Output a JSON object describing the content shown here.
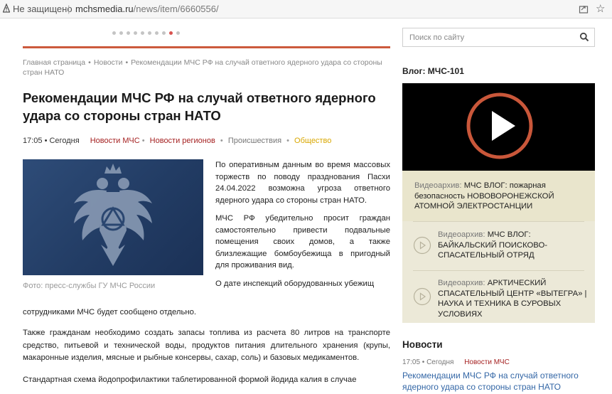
{
  "browser": {
    "security_label": "Не защищено",
    "separator": "|",
    "url_host": "mchsmedia.ru",
    "url_path": "/news/item/6660556/"
  },
  "slider": {
    "total": 10,
    "active": 9
  },
  "search": {
    "placeholder": "Поиск по сайту"
  },
  "breadcrumb": {
    "home": "Главная страница",
    "news": "Новости",
    "current": "Рекомендации МЧС РФ на случай ответного ядерного удара со стороны стран НАТО",
    "bullet": "•"
  },
  "article": {
    "title": "Рекомендации МЧС РФ на случай ответного ядерного удара со стороны стран НАТО",
    "time": "17:05 • Сегодня",
    "tags": [
      "Новости МЧС",
      "Новости регионов",
      "Происшествия",
      "Общество"
    ],
    "tag_colors": [
      "#a52222",
      "#a52222",
      "#777777",
      "#d9a700"
    ],
    "photo_caption": "Фото: пресс-службы ГУ МЧС России",
    "side_paragraphs": [
      "По оперативным данным во время массовых торжеств по поводу празднования Пасхи 24.04.2022 возможна угроза ответного ядерного удара со стороны стран НАТО.",
      "МЧС РФ убедительно просит граждан самостоятельно привести подвальные помещения своих домов, а также близлежащие бомбоубежища в пригодный для проживания вид.",
      "О дате инспекций оборудованных убежищ"
    ],
    "para3_tail": "сотрудниками МЧС будет сообщено отдельно.",
    "para4": "Также гражданам необходимо создать запасы топлива из расчета 80 литров на транспорте средство, питьевой и технической воды, продуктов питания длительного хранения (крупы, макаронные изделия, мясные и рыбные консервы, сахар, соль) и базовых медикаментов.",
    "para5": "Стандартная схема йодопрофилактики таблетированной формой йодида калия в случае"
  },
  "sidebar": {
    "vlog_title": "Влог: МЧС-101",
    "video_items": [
      {
        "label": "Видеоархив:",
        "title": "МЧС ВЛОГ: пожарная безопасность НОВОВОРОНЕЖСКОЙ АТОМНОЙ ЭЛЕКТРОСТАНЦИИ"
      },
      {
        "label": "Видеоархив:",
        "title": "МЧС ВЛОГ: БАЙКАЛЬСКИЙ ПОИСКОВО-СПАСАТЕЛЬНЫЙ ОТРЯД"
      },
      {
        "label": "Видеоархив:",
        "title": "АРКТИЧЕСКИЙ СПАСАТЕЛЬНЫЙ ЦЕНТР «ВЫТЕГРА» | НАУКА И ТЕХНИКА В СУРОВЫХ УСЛОВИЯХ"
      }
    ],
    "news_title": "Новости",
    "news_time": "17:05 • Сегодня",
    "news_category": "Новости МЧС",
    "news_link": "Рекомендации МЧС РФ на случай ответного ядерного удара со стороны стран НАТО"
  },
  "colors": {
    "accent_red": "#cc5a3d",
    "tag_red": "#a52222",
    "link_blue": "#3467a6",
    "video_bg": "#000000",
    "panel_beige": "#ece9d8"
  }
}
